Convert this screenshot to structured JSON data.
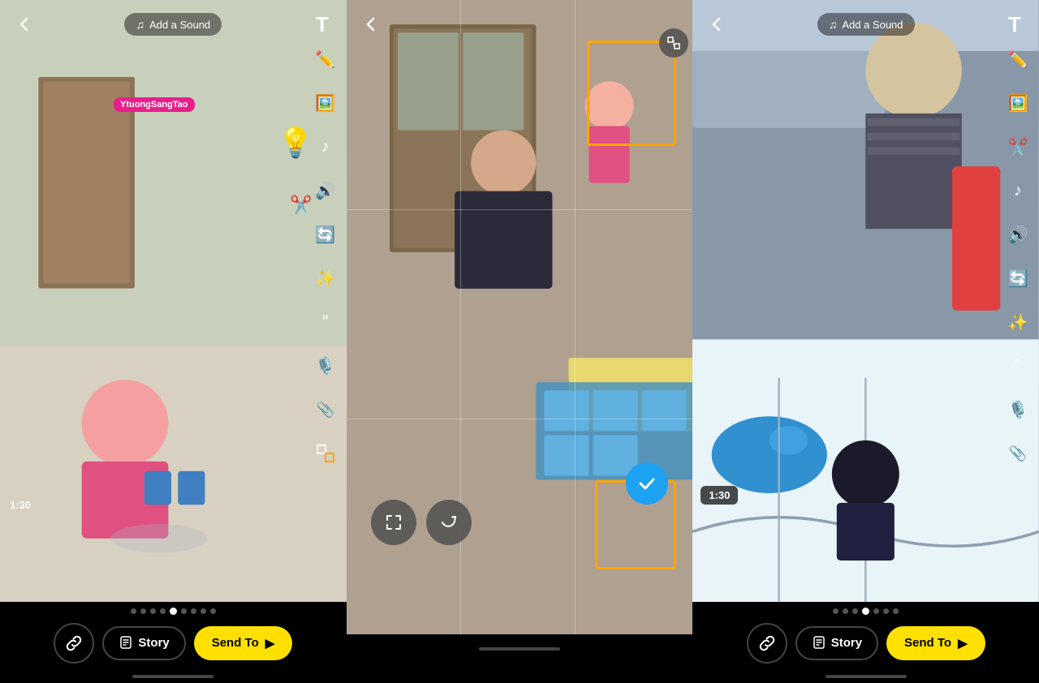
{
  "panels": [
    {
      "id": "left",
      "header": {
        "back_label": "‹",
        "add_sound_icon": "♫",
        "add_sound_label": "Add a Sound",
        "text_tool_label": "T"
      },
      "tools": [
        "T",
        "✏",
        "🖼",
        "♪",
        "🔊",
        "↺",
        "✨",
        "❝",
        "🎙",
        "🔗",
        "⬚"
      ],
      "timeline": {
        "time": "1:30",
        "dots": [
          false,
          false,
          false,
          false,
          true,
          false,
          false,
          false,
          false
        ]
      },
      "actions": {
        "link_icon": "🔗",
        "story_icon": "↑",
        "story_label": "Story",
        "send_label": "Send To",
        "send_icon": "▶"
      },
      "sticker": "YtuongSangTao"
    },
    {
      "id": "middle",
      "header": {
        "back_label": "‹"
      },
      "crop_active": true,
      "edit_btns": [
        "⤢",
        "↺"
      ],
      "blue_check": "✓"
    },
    {
      "id": "right",
      "header": {
        "back_label": "‹",
        "add_sound_icon": "♫",
        "add_sound_label": "Add a Sound",
        "text_tool_label": "T"
      },
      "tools": [
        "T",
        "✏",
        "🖼",
        "✂",
        "♪",
        "🔊",
        "↺",
        "✨",
        "❝",
        "🎙",
        "🔗"
      ],
      "timeline": {
        "time": "1:30",
        "dots": [
          false,
          false,
          false,
          true,
          false,
          false,
          false
        ]
      },
      "actions": {
        "link_icon": "🔗",
        "story_icon": "↑",
        "story_label": "Story",
        "send_label": "Send To",
        "send_icon": "▶"
      }
    }
  ],
  "colors": {
    "yellow": "#FFE000",
    "orange": "#FFA500",
    "blue": "#1DA1F2",
    "pink": "#e91e8c"
  }
}
